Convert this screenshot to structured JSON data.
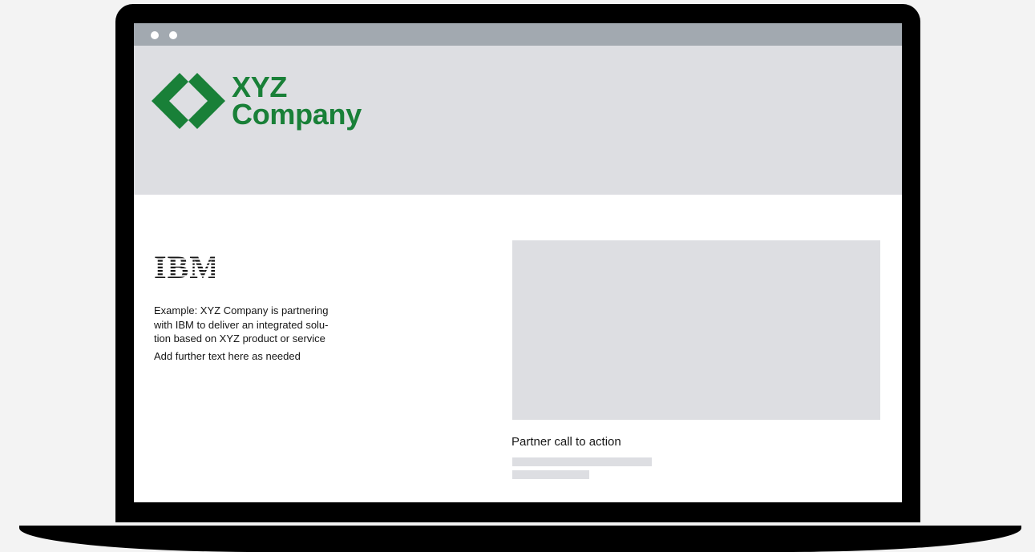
{
  "colors": {
    "background": "#f3f3f3",
    "laptop_frame": "#000000",
    "browser_bar": "#a2a9b0",
    "header_band": "#dddee2",
    "brand_green": "#198038",
    "placeholder": "#dddee2",
    "text": "#161616"
  },
  "browser": {
    "window_dots": [
      "window-dot",
      "window-dot"
    ]
  },
  "header": {
    "logo_icon": "diamond-chevron-logo-icon",
    "company_line1": "XYZ",
    "company_line2": "Company"
  },
  "main": {
    "partner_logo_text": "IBM",
    "description_lines": [
      "Example: XYZ Company is partnering",
      "with IBM to deliver an integrated solu-",
      "tion based on XYZ product or service"
    ],
    "extra_text": "Add further text here as needed",
    "cta_label": "Partner call to action"
  }
}
